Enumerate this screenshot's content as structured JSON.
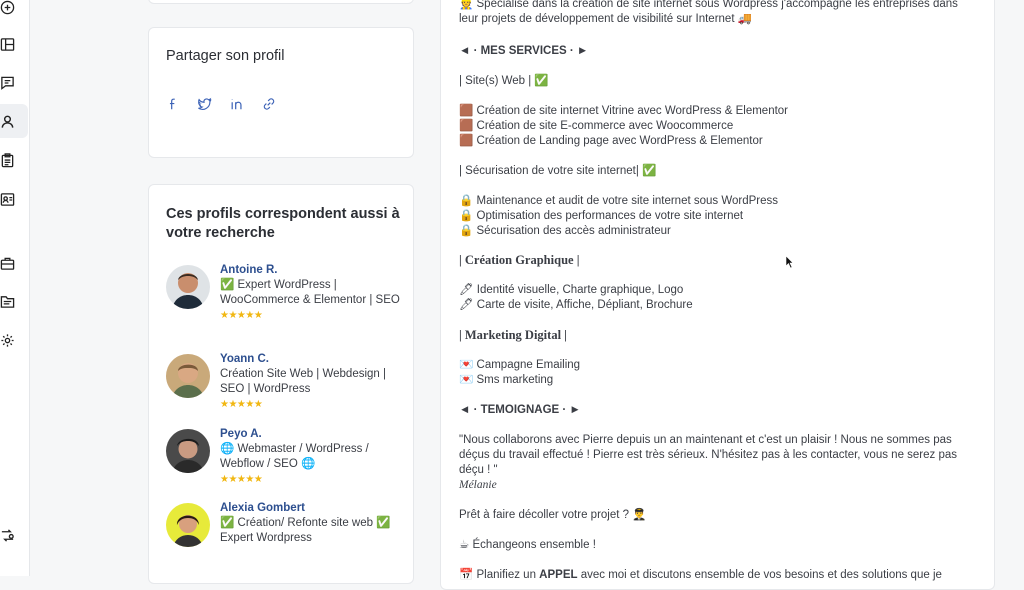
{
  "sidebar": {
    "items": [
      {
        "icon": "add-circle-icon"
      },
      {
        "icon": "layout-icon"
      },
      {
        "icon": "chat-icon"
      },
      {
        "icon": "profile-icon",
        "active": true
      },
      {
        "icon": "clipboard-icon"
      },
      {
        "icon": "id-card-icon"
      },
      {
        "icon": "briefcase-icon"
      },
      {
        "icon": "folder-icon"
      },
      {
        "icon": "settings-icon"
      },
      {
        "icon": "switch-icon"
      }
    ]
  },
  "share": {
    "title": "Partager son profil",
    "icons": [
      "facebook-icon",
      "twitter-icon",
      "linkedin-icon",
      "link-icon"
    ]
  },
  "similar": {
    "title": "Ces profils correspondent aussi à votre recherche",
    "stars": "★★★★★",
    "profiles": [
      {
        "name": "Antoine R.",
        "desc": "✅ Expert WordPress | WooCommerce & Elementor | SEO"
      },
      {
        "name": "Yoann C.",
        "desc": "Création Site Web | Webdesign | SEO | WordPress"
      },
      {
        "name": "Peyo A.",
        "desc": "🌐 Webmaster / WordPress / Webflow / SEO 🌐"
      },
      {
        "name": "Alexia Gombert",
        "desc": "✅ Création/ Refonte site web ✅ Expert Wordpress"
      }
    ]
  },
  "description": {
    "intro": "👷 Spécialisé dans la création de site internet sous Wordpress j'accompagne les entreprises dans leur projets de développement de visibilité sur Internet 🚚",
    "services_header": "◄ · MES SERVICES · ►",
    "sites_header": "| Site(s) Web | ✅",
    "sites_items": [
      "🟫 Création de site internet Vitrine avec WordPress & Elementor",
      "🟫 Création de site E-commerce avec Woocommerce",
      "🟫 Création de Landing page avec WordPress & Elementor"
    ],
    "security_header": "| Sécurisation de votre site internet| ✅",
    "security_items": [
      "🔒 Maintenance et audit de votre site internet sous WordPress",
      "🔒 Optimisation des performances de votre site internet",
      "🔒 Sécurisation des accès administrateur"
    ],
    "graphic_header": "| Création Graphique |",
    "graphic_items": [
      "🖊 Identité visuelle, Charte graphique, Logo",
      "🖊 Carte de visite, Affiche, Dépliant, Brochure"
    ],
    "marketing_header": "| Marketing Digital |",
    "marketing_items": [
      "💌 Campagne Emailing",
      "💌 Sms marketing"
    ],
    "testimony_header": "◄ · TEMOIGNAGE · ►",
    "testimony_text": "\"Nous collaborons avec Pierre depuis un an maintenant et c'est un plaisir ! Nous ne sommes pas déçus du travail effectué ! Pierre est très sérieux. N'hésitez pas à les contacter, vous ne serez pas déçu ! \"",
    "testimony_author": "Mélanie",
    "cta1": "Prêt à faire décoller votre projet ? 👨‍✈️",
    "cta2": "☕ Échangeons ensemble !",
    "cta3_prefix": "📅 Planifiez un ",
    "cta3_bold": "APPEL",
    "cta3_suffix": " avec moi et discutons ensemble de vos besoins et des solutions que je"
  }
}
